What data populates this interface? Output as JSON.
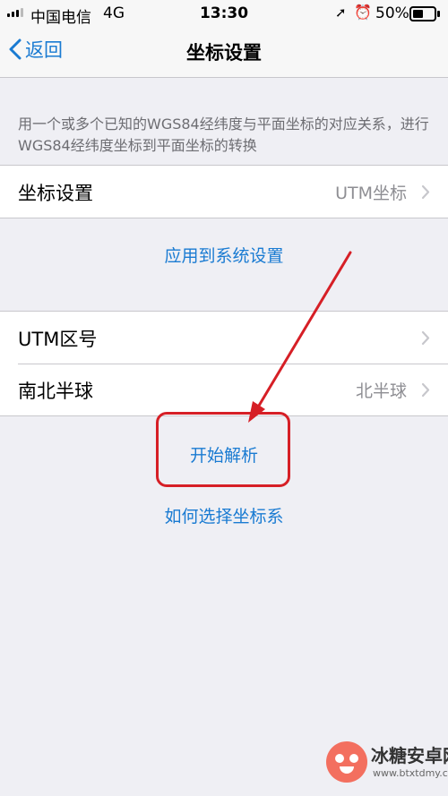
{
  "status_bar": {
    "carrier": "中国电信",
    "network": "4G",
    "time": "13:30",
    "battery_percent": "50%",
    "battery_level": 0.5,
    "icons": [
      "signal-icon",
      "location-arrow-icon",
      "alarm-clock-icon",
      "battery-icon"
    ]
  },
  "nav": {
    "back_label": "返回",
    "title": "坐标设置"
  },
  "description": "用一个或多个已知的WGS84经纬度与平面坐标的对应关系，进行WGS84经纬度坐标到平面坐标的转换",
  "settings_group_1": {
    "rows": [
      {
        "label": "坐标设置",
        "value": "UTM坐标"
      }
    ]
  },
  "apply_link": "应用到系统设置",
  "settings_group_2": {
    "rows": [
      {
        "label": "UTM区号",
        "value": ""
      },
      {
        "label": "南北半球",
        "value": "北半球"
      }
    ]
  },
  "start_parse_link": "开始解析",
  "how_to_choose_link": "如何选择坐标系",
  "watermark": {
    "brand": "冰糖安卓网",
    "site": "www.btxtdmy.com"
  },
  "colors": {
    "accent": "#1a7bd2",
    "background": "#efeff4",
    "annotation": "#d61f26"
  }
}
